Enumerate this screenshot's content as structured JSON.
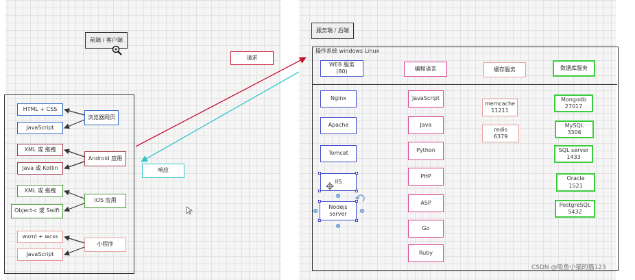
{
  "client": {
    "title": "前端 / 客户端",
    "web": {
      "items": [
        "HTML + CSS",
        "JavaScript"
      ],
      "group": "浏览器网页"
    },
    "android": {
      "items": [
        "XML 或 拖拽",
        "Java 或 Kotlin"
      ],
      "group": "Android 应用"
    },
    "ios": {
      "items": [
        "XML 或 拖拽",
        "Object-c 或 Swift"
      ],
      "group": "IOS 应用"
    },
    "miniprogram": {
      "items": [
        "wxml + wcss",
        "JavaScript"
      ],
      "group": "小程序"
    }
  },
  "flow": {
    "request": "请求",
    "response": "响应"
  },
  "server": {
    "title": "服务端 / 后端",
    "os_label": "操作系统  windows  Linux",
    "web_server": {
      "header": "WEB 服务\n(80)",
      "items": [
        "Nginx",
        "Apache",
        "Tomcat",
        "IIS",
        "Nodejs\nserver"
      ]
    },
    "languages": {
      "header": "编程语言",
      "items": [
        "JavaScript",
        "Java",
        "Python",
        "PHP",
        "ASP",
        "Go",
        "Ruby"
      ]
    },
    "cache": {
      "header": "缓存服务",
      "items": [
        "memcache\n11211",
        "redis\n6379"
      ]
    },
    "database": {
      "header": "数据库服务",
      "items": [
        "Mongodb\n27017",
        "MySQL\n3306",
        "SQL server\n1433",
        "Oracle\n1521",
        "PostgreSQL\n5432"
      ]
    }
  },
  "watermark": "CSDN @吸鱼小猫的猫123",
  "colors": {
    "web_blue": "#3f4bc9",
    "android_red": "#a33a4a",
    "ios_green": "#4a9a3a",
    "mini_salmon": "#e79a9a",
    "lang_pink": "#d8408e",
    "db_green": "#3bcc3b",
    "request_red": "#c8102e",
    "response_cyan": "#35c5c8"
  },
  "icons": [
    "zoom-in-cursor-icon",
    "mouse-pointer-icon",
    "move-cursor-icon",
    "rotate-handle-icon"
  ]
}
